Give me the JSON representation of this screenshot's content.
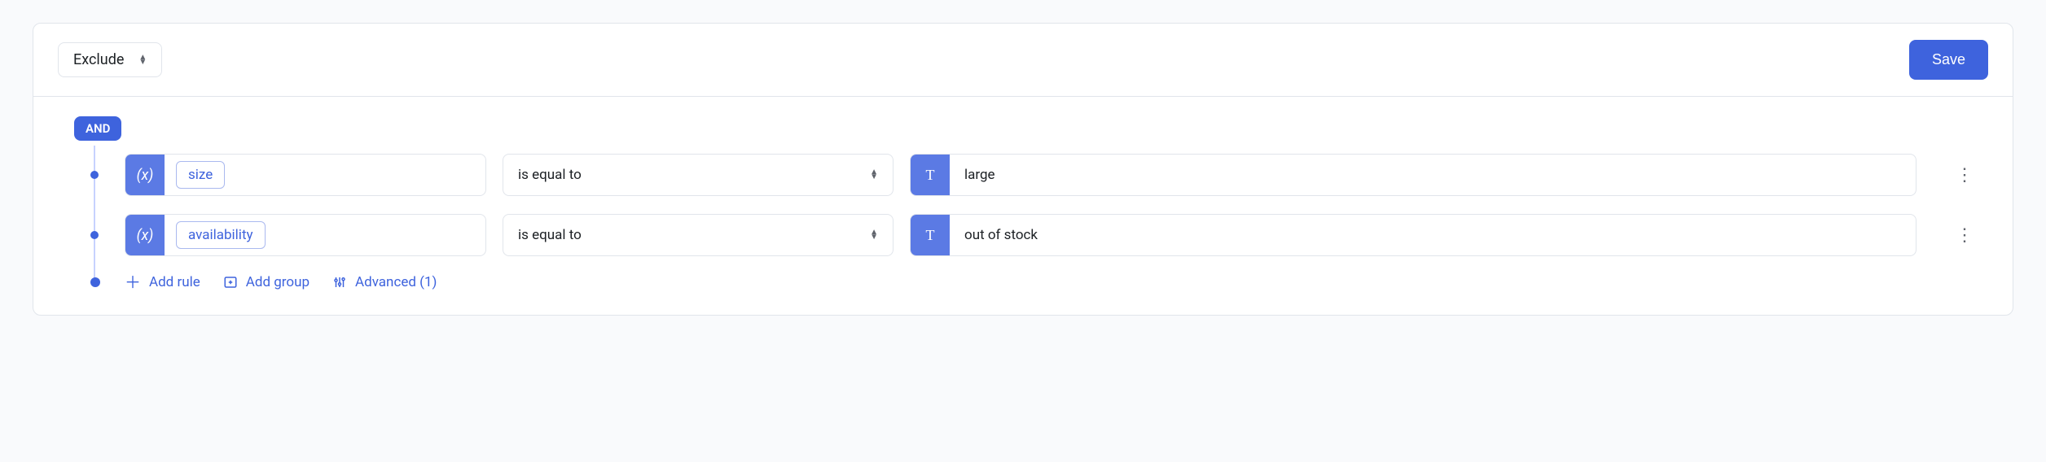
{
  "topbar": {
    "mode_label": "Exclude",
    "save_label": "Save"
  },
  "group": {
    "conjunction": "AND"
  },
  "rules": [
    {
      "attribute": "size",
      "operator": "is equal to",
      "value": "large"
    },
    {
      "attribute": "availability",
      "operator": "is equal to",
      "value": "out of stock"
    }
  ],
  "actions": {
    "add_rule": "Add rule",
    "add_group": "Add group",
    "advanced": "Advanced (1)"
  },
  "icons": {
    "variable": "(x)",
    "text": "T"
  }
}
